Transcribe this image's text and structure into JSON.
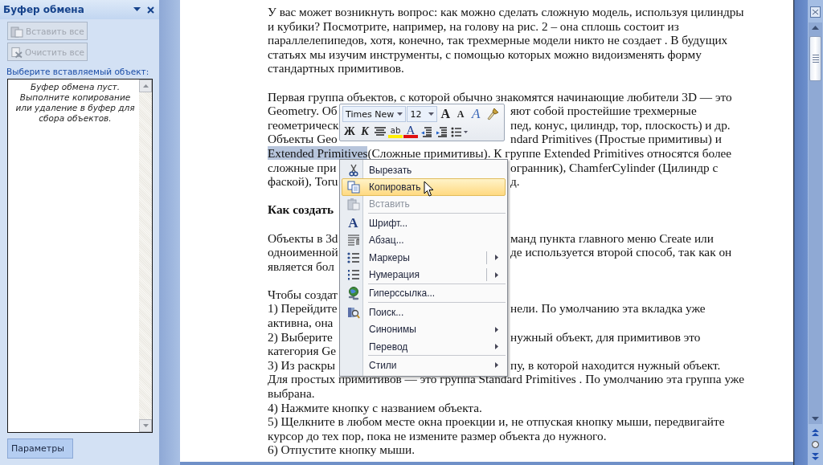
{
  "task_pane": {
    "title": "Буфер обмена",
    "buttons": [
      {
        "label": "Вставить все",
        "disabled": true
      },
      {
        "label": "Очистить все",
        "disabled": true
      }
    ],
    "prompt": "Выберите вставляемый объект:",
    "empty_message": "Буфер обмена пуст. Выполните копирование или удаление в буфер для сбора объектов.",
    "options_button": "Параметры"
  },
  "document": {
    "paragraphs": [
      {
        "kind": "body",
        "lines": [
          {
            "text": "У вас может возникнуть вопрос: как можно сделать сложную модель, используя цилиндры"
          },
          {
            "text": "и кубики? Посмотрите, например, на голову на рис. 2 – она сплошь состоит из"
          },
          {
            "text": "параллелепипедов, хотя, конечно, так трехмерные модели никто не создает . В будущих"
          },
          {
            "text": "статьях мы изучим инструменты, с помощью которых можно видоизменять форму"
          },
          {
            "text": "стандартных примитивов."
          }
        ]
      },
      {
        "kind": "body",
        "lines": [
          {
            "text": "Первая группа объектов, с которой обычно знакомятся начинающие любители 3D — это"
          },
          {
            "text": "Geometry. Об",
            "after_gap": "яют собой простейшие трехмерные"
          },
          {
            "text": "геометрическ",
            "after_gap": "пед, конус, цилиндр, тор, плоскость) и др."
          },
          {
            "text": "Объекты Geo",
            "after_gap": "ndard Primitives (Простые примитивы) и"
          },
          {
            "highlighted": "Extended Primitives",
            "text": "(Сложные примитивы). К группе Extended Primitives относятся более"
          },
          {
            "text": "сложные при",
            "after_gap": "огранник), ChamferCylinder (Цилиндр с"
          },
          {
            "text": "фаской), Toru",
            "after_gap": "д."
          }
        ]
      },
      {
        "kind": "heading",
        "lines": [
          {
            "text": "Как создать"
          }
        ]
      },
      {
        "kind": "body",
        "lines": [
          {
            "text": "Объекты в 3d",
            "after_gap": "манд пункта главного меню Create или"
          },
          {
            "text": "одноименной",
            "after_gap": "де используется второй способ, так как он"
          },
          {
            "text": "является бол"
          }
        ]
      },
      {
        "kind": "body",
        "lines": [
          {
            "text": "Чтобы создат"
          },
          {
            "text": "1) Перейдите",
            "after_gap": "нели. По умолчанию эта вкладка уже"
          },
          {
            "text": "активна, она"
          },
          {
            "text": "2) Выберите",
            "after_gap": "нужный объект, для примитивов это"
          },
          {
            "text": "категория Ge"
          },
          {
            "text": "3) Из раскры",
            "after_gap": "пу, в которой находится нужный объект."
          },
          {
            "text": "Для простых примитивов — это группа Standard Primitives . По умолчанию эта группа уже"
          },
          {
            "text": "выбрана."
          },
          {
            "text": "4) Нажмите кнопку  с названием объекта."
          },
          {
            "text": "5) Щелкните в любом месте окна проекции и, не отпуская кнопку мыши, передвигайте"
          },
          {
            "text": "курсор до тех пор, пока не измените размер объекта до нужного."
          },
          {
            "text": "6) Отпустите кнопку мыши."
          }
        ]
      }
    ]
  },
  "mini_toolbar": {
    "font": "Times New",
    "size": "12",
    "buttons": [
      {
        "kind": "grow",
        "glyph": "A"
      },
      {
        "kind": "shrink",
        "glyph": "A"
      },
      {
        "kind": "styles",
        "glyph": "A"
      },
      {
        "kind": "painter"
      },
      {
        "kind": "bold",
        "glyph": "Ж"
      },
      {
        "kind": "italic",
        "glyph": "К"
      },
      {
        "kind": "align"
      },
      {
        "kind": "highlight",
        "glyph": "ab"
      },
      {
        "kind": "color",
        "glyph": "A"
      },
      {
        "kind": "outdent"
      },
      {
        "kind": "indent"
      },
      {
        "kind": "bullets"
      }
    ]
  },
  "context_menu": {
    "groups": [
      [
        {
          "label": "Вырезать",
          "kind": "command",
          "selected": false,
          "disabled": false
        },
        {
          "label": "Копировать",
          "kind": "command",
          "selected": true,
          "disabled": false
        },
        {
          "label": "Вставить",
          "kind": "command",
          "selected": false,
          "disabled": true
        }
      ],
      [
        {
          "label": "Шрифт...",
          "kind": "command",
          "selected": false,
          "disabled": false,
          "glyph": "A"
        },
        {
          "label": "Абзац...",
          "kind": "command",
          "selected": false,
          "disabled": false
        },
        {
          "label": "Маркеры",
          "kind": "split_submenu",
          "selected": false,
          "disabled": false
        },
        {
          "label": "Нумерация",
          "kind": "split_submenu",
          "selected": false,
          "disabled": false
        }
      ],
      [
        {
          "label": "Гиперссылка...",
          "kind": "command",
          "selected": false,
          "disabled": false
        }
      ],
      [
        {
          "label": "Поиск...",
          "kind": "command",
          "selected": false,
          "disabled": false
        },
        {
          "label": "Синонимы",
          "kind": "submenu",
          "selected": false,
          "disabled": false
        },
        {
          "label": "Перевод",
          "kind": "submenu",
          "selected": false,
          "disabled": false
        }
      ],
      [
        {
          "label": "Стили",
          "kind": "submenu",
          "selected": false,
          "disabled": false
        }
      ]
    ]
  }
}
